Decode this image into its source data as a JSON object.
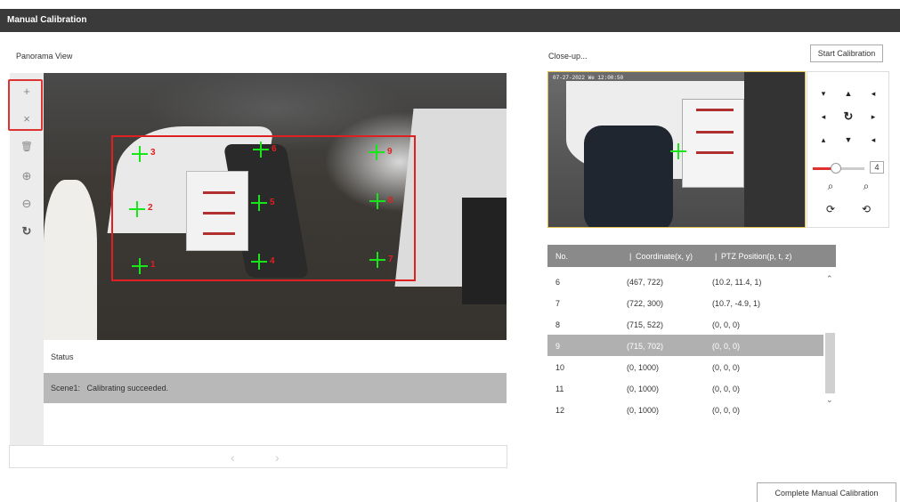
{
  "title": "Manual Calibration",
  "panorama": {
    "label": "Panorama View",
    "points": [
      {
        "num": "1"
      },
      {
        "num": "2"
      },
      {
        "num": "3"
      },
      {
        "num": "4"
      },
      {
        "num": "5"
      },
      {
        "num": "6"
      },
      {
        "num": "7"
      },
      {
        "num": "8"
      },
      {
        "num": "9"
      }
    ]
  },
  "toolbar": {
    "add_icon": "+",
    "delete_icon": "×",
    "trash_icon": "🗑",
    "zoom_in_icon": "⊕",
    "zoom_out_icon": "⊖",
    "refresh_icon": "↻"
  },
  "status": {
    "label": "Status",
    "message": "Scene1:   Calibrating succeeded."
  },
  "pager": {
    "prev": "‹",
    "next": "›"
  },
  "closeup": {
    "label": "Close-up...",
    "start_button": "Start Calibration",
    "osd": "07-27-2022 We 12:00:50"
  },
  "ptz": {
    "up_left": "▾",
    "up": "▲",
    "up_right": "◂",
    "left": "◂",
    "center": "↻",
    "right": "▸",
    "down_left": "▴",
    "down": "▼",
    "down_right": "◂",
    "zoom_value": "4",
    "zoom_level": 0.45,
    "zoom_in": "⌕",
    "zoom_out": "⌕",
    "focus_near": "⟳",
    "focus_far": "⟲"
  },
  "table": {
    "headers": [
      "No.",
      "Coordinate(x, y)",
      "PTZ Position(p, t, z)"
    ],
    "rows": [
      {
        "no": "6",
        "coord": "(467, 722)",
        "ptz": "(10.2, 11.4, 1)"
      },
      {
        "no": "7",
        "coord": "(722, 300)",
        "ptz": "(10.7, -4.9, 1)"
      },
      {
        "no": "8",
        "coord": "(715, 522)",
        "ptz": "(0, 0, 0)"
      },
      {
        "no": "9",
        "coord": "(715, 702)",
        "ptz": "(0, 0, 0)"
      },
      {
        "no": "10",
        "coord": "(0, 1000)",
        "ptz": "(0, 0, 0)"
      },
      {
        "no": "11",
        "coord": "(0, 1000)",
        "ptz": "(0, 0, 0)"
      },
      {
        "no": "12",
        "coord": "(0, 1000)",
        "ptz": "(0, 0, 0)"
      }
    ],
    "selected_row": "9",
    "scroll_up": "⌃",
    "scroll_down": "⌄"
  },
  "complete_button": "Complete Manual Calibration",
  "colors": {
    "titlebar": "#3a3a3a",
    "calibration_rect": "#e02020",
    "marker": "#19e619",
    "selected_row": "#b0b0b0"
  }
}
